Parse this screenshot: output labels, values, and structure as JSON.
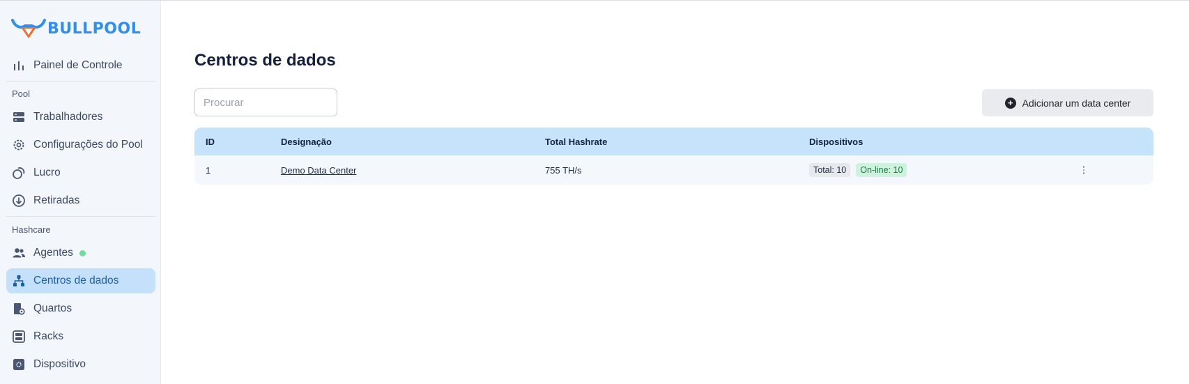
{
  "brand": {
    "name": "BULLPOOL",
    "logo_icon": "bull-logo-icon",
    "accent": "#2e8ef2"
  },
  "sidebar": {
    "top_items": [
      {
        "label": "Painel de Controle",
        "icon": "bar-chart-icon"
      }
    ],
    "sections": [
      {
        "title": "Pool",
        "items": [
          {
            "label": "Trabalhadores",
            "icon": "server-icon"
          },
          {
            "label": "Configurações do Pool",
            "icon": "gear-icon"
          },
          {
            "label": "Lucro",
            "icon": "coins-icon"
          },
          {
            "label": "Retiradas",
            "icon": "arrow-down-circle-icon"
          }
        ]
      },
      {
        "title": "Hashcare",
        "items": [
          {
            "label": "Agentes",
            "icon": "users-icon",
            "status": "online"
          },
          {
            "label": "Centros de dados",
            "icon": "hierarchy-icon",
            "active": true
          },
          {
            "label": "Quartos",
            "icon": "door-gear-icon"
          },
          {
            "label": "Racks",
            "icon": "rack-icon"
          },
          {
            "label": "Dispositivo",
            "icon": "device-chip-icon"
          }
        ]
      }
    ]
  },
  "main": {
    "title": "Centros de dados",
    "search": {
      "placeholder": "Procurar",
      "value": ""
    },
    "add_button": {
      "label": "Adicionar um data center",
      "icon": "plus-circle-icon"
    },
    "table": {
      "columns": [
        "ID",
        "Designação",
        "Total Hashrate",
        "Dispositivos"
      ],
      "rows": [
        {
          "id": "1",
          "name": "Demo Data Center",
          "hashrate": "755 TH/s",
          "devices_total": "Total: 10",
          "devices_online": "On-line: 10"
        }
      ]
    }
  },
  "colors": {
    "active_bg": "#c4e0fb",
    "table_header_bg": "#c6e3fb",
    "online_badge_bg": "#cdf3dc",
    "online_dot": "#6fdca0"
  }
}
